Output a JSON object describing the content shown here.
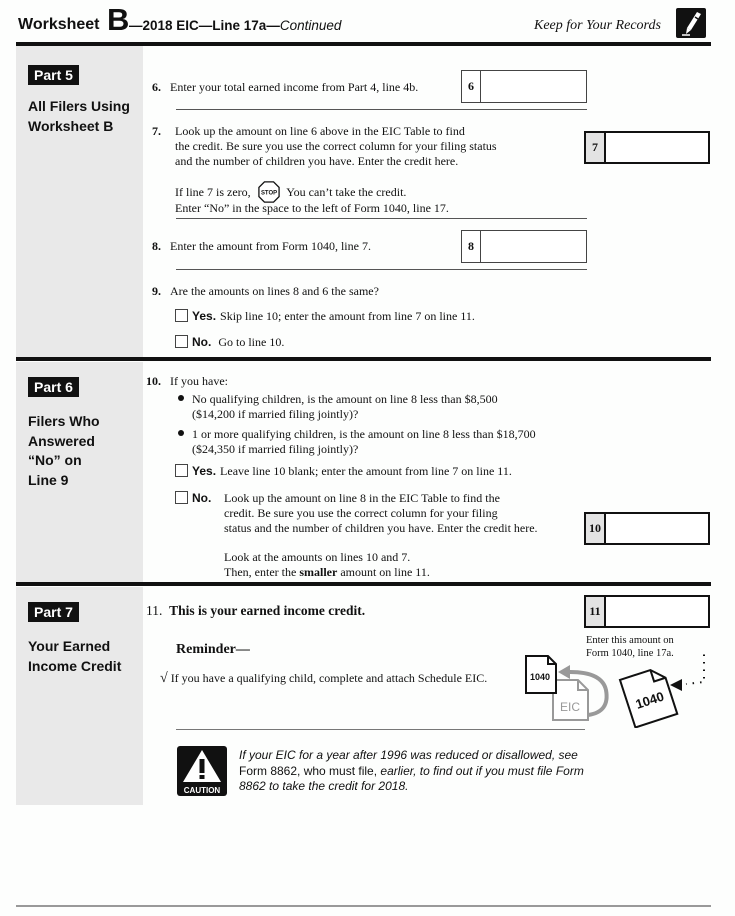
{
  "header": {
    "worksheet": "Worksheet",
    "letter": "B",
    "subtitle": "—2018 EIC—Line 17a—",
    "continued": "Continued",
    "keep": "Keep for Your Records",
    "keep_icon": "pencil-icon"
  },
  "parts": [
    {
      "badge": "Part 5",
      "title": "All Filers Using Worksheet B"
    },
    {
      "badge": "Part 6",
      "title_lines": [
        "Filers Who",
        "Answered",
        "“No” on",
        "Line 9"
      ]
    },
    {
      "badge": "Part 7",
      "title_lines": [
        "Your Earned",
        "Income Credit"
      ]
    }
  ],
  "part5_title_lines": [
    "All Filers Using",
    "Worksheet B"
  ],
  "lines": {
    "l6": {
      "num": "6.",
      "text": "Enter your total earned income from Part 4, line 4b.",
      "box": "6",
      "value": ""
    },
    "l7": {
      "num": "7.",
      "text": [
        "Look up the amount on line 6 above in the EIC Table to find",
        "the credit. Be sure you use the correct column for your filing status",
        "and the number of children you have. Enter the credit here."
      ],
      "box": "7",
      "value": "",
      "stop_pre": "If line 7 is zero,",
      "stop_label": "STOP",
      "stop_post": "You can’t take the credit.",
      "stop_line2": "Enter “No” in the space to the left of Form 1040, line 17."
    },
    "l8": {
      "num": "8.",
      "text": "Enter the amount from Form 1040, line 7.",
      "box": "8",
      "value": ""
    },
    "l9": {
      "num": "9.",
      "text": "Are the amounts on lines 8 and 6 the same?",
      "yes_label": "Yes.",
      "yes_text": "Skip line 10; enter the amount from line 7 on line 11.",
      "no_label": "No.",
      "no_text": "Go to line 10."
    },
    "l10": {
      "num": "10.",
      "intro": "If you have:",
      "bullets": [
        [
          "No qualifying children, is the amount on line 8 less than $8,500",
          "($14,200 if married filing jointly)?"
        ],
        [
          "1 or more qualifying children, is the amount on line 8 less than $18,700",
          "($24,350 if married filing jointly)?"
        ]
      ],
      "yes_label": "Yes.",
      "yes_text": "Leave line 10 blank; enter the amount from line 7 on line 11.",
      "no_label": "No.",
      "no_text": [
        "Look up the amount on line 8 in the EIC Table to find the",
        "credit. Be sure you use the correct column for your filing",
        "status and the number of children you have. Enter the credit here."
      ],
      "box": "10",
      "value": "",
      "look1": "Look at the amounts on lines 10 and 7.",
      "look2_pre": "Then, enter the",
      "look2_bold": "smaller",
      "look2_post": "amount on line 11."
    },
    "l11": {
      "num": "11.",
      "text": "This is your earned income credit.",
      "box": "11",
      "value": "",
      "enter_note": [
        "Enter this amount on",
        "Form 1040, line 17a."
      ],
      "reminder": "Reminder—",
      "check": "√",
      "reminder_text": "If you have a qualifying child, complete and attach Schedule EIC.",
      "doc_1040": "1040",
      "doc_eic": "EIC",
      "doc_1040_large": "1040"
    }
  },
  "caution": {
    "icon_label": "CAUTION",
    "line1": "If your EIC for a year after 1996 was reduced or disallowed, see",
    "line2_pre": "Form 8862, who must file, ",
    "line2_it": "earlier",
    "line2_post": ", to find out if you must file Form",
    "line3": "8862 to take the credit for 2018."
  }
}
